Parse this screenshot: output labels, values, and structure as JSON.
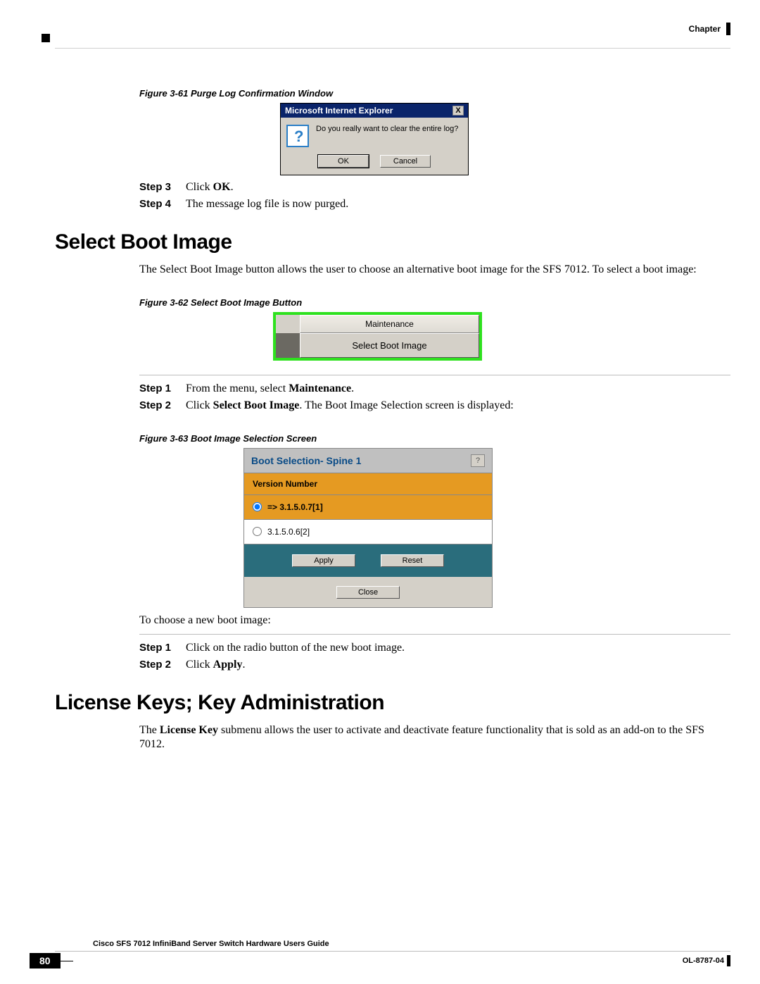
{
  "header": {
    "chapter": "Chapter"
  },
  "figures": {
    "f61": {
      "caption": "Figure 3-61  Purge Log Confirmation Window"
    },
    "f62": {
      "caption": "Figure 3-62  Select Boot Image Button"
    },
    "f63": {
      "caption": "Figure 3-63  Boot Image Selection Screen"
    }
  },
  "dialog1": {
    "title": "Microsoft Internet Explorer",
    "message": "Do you really want to clear the entire log?",
    "ok": "OK",
    "cancel": "Cancel",
    "close_x": "X"
  },
  "steps_a": {
    "s3_label": "Step 3",
    "s3_pre": "Click ",
    "s3_bold": "OK",
    "s3_post": ".",
    "s4_label": "Step 4",
    "s4_text": "The message log file is now purged."
  },
  "sections": {
    "select_boot": "Select Boot Image",
    "license_keys": "License Keys; Key Administration"
  },
  "para_select_boot": "The Select Boot Image button allows the user to choose an alternative boot image for the SFS 7012. To select a boot image:",
  "fig62": {
    "maintenance": "Maintenance",
    "select_boot": "Select Boot Image"
  },
  "steps_b": {
    "s1_label": "Step 1",
    "s1_pre": "From the menu, select ",
    "s1_bold": "Maintenance",
    "s1_post": ".",
    "s2_label": "Step 2",
    "s2_pre": "Click ",
    "s2_bold": "Select Boot Image",
    "s2_post": ". The Boot Image Selection screen is displayed:"
  },
  "fig63": {
    "title": "Boot Selection- Spine 1",
    "help": "?",
    "header": "Version Number",
    "opt1": "=> 3.1.5.0.7[1]",
    "opt2": "3.1.5.0.6[2]",
    "apply": "Apply",
    "reset": "Reset",
    "close": "Close"
  },
  "para_choose": "To choose a new boot image:",
  "steps_c": {
    "s1_label": "Step 1",
    "s1_text": "Click on the radio button of the new boot image.",
    "s2_label": "Step 2",
    "s2_pre": "Click ",
    "s2_bold": "Apply",
    "s2_post": "."
  },
  "para_license_pre": "The ",
  "para_license_bold": "License Key",
  "para_license_post": " submenu allows the user to activate and deactivate feature functionality that is sold as an add-on to the SFS 7012.",
  "footer": {
    "title": "Cisco SFS 7012 InfiniBand Server Switch Hardware Users Guide",
    "page": "80",
    "doc_id": "OL-8787-04"
  }
}
